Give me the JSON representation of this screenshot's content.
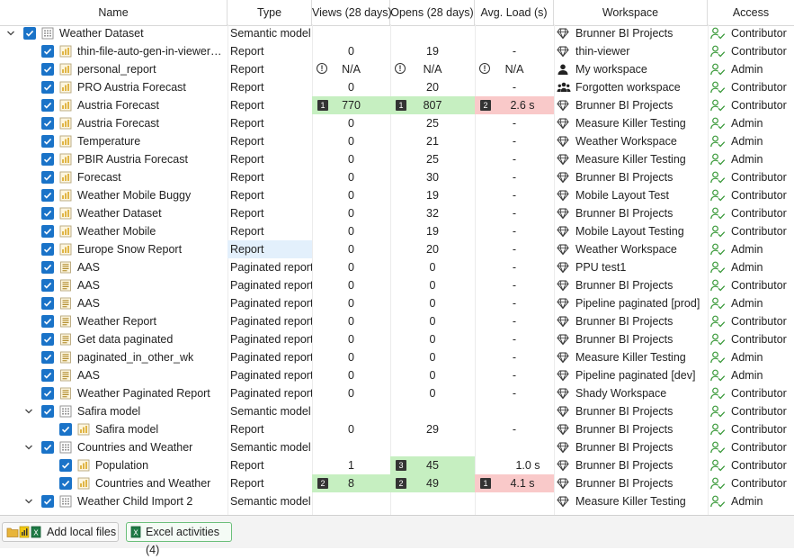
{
  "columns": {
    "name": "Name",
    "type": "Type",
    "views": "Views (28 days)",
    "opens": "Opens (28 days)",
    "load": "Avg. Load (s)",
    "workspace": "Workspace",
    "access": "Access"
  },
  "rows": [
    {
      "indent": 0,
      "expander": "down",
      "icon": "dataset",
      "name": "Weather Dataset",
      "type": "Semantic model",
      "views": "",
      "opens": "",
      "load": "",
      "ws_icon": "diamond",
      "workspace": "Brunner BI Projects",
      "access": "Contributor"
    },
    {
      "indent": 1,
      "icon": "report",
      "name": "thin-file-auto-gen-in-viewer…",
      "type": "Report",
      "views": "0",
      "opens": "19",
      "load": "-",
      "ws_icon": "diamond",
      "workspace": "thin-viewer",
      "access": "Contributor"
    },
    {
      "indent": 1,
      "icon": "report",
      "name": "personal_report",
      "type": "Report",
      "views": "N/A",
      "opens": "N/A",
      "load": "N/A",
      "warn": true,
      "ws_icon": "person",
      "workspace": "My workspace",
      "access": "Admin"
    },
    {
      "indent": 1,
      "icon": "report",
      "name": "PRO Austria Forecast",
      "type": "Report",
      "views": "0",
      "opens": "20",
      "load": "-",
      "ws_icon": "group",
      "workspace": "Forgotten workspace",
      "access": "Contributor"
    },
    {
      "indent": 1,
      "icon": "report",
      "name": "Austria Forecast",
      "type": "Report",
      "views": "770",
      "opens": "807",
      "load": "2.6 s",
      "views_rank": "1",
      "opens_rank": "1",
      "load_rank": "2",
      "views_hl": "green",
      "opens_hl": "green",
      "load_hl": "red",
      "ws_icon": "diamond",
      "workspace": "Brunner BI Projects",
      "access": "Contributor"
    },
    {
      "indent": 1,
      "icon": "report",
      "name": "Austria Forecast",
      "type": "Report",
      "views": "0",
      "opens": "25",
      "load": "-",
      "ws_icon": "diamond",
      "workspace": "Measure Killer Testing",
      "access": "Admin"
    },
    {
      "indent": 1,
      "icon": "report",
      "name": "Temperature",
      "type": "Report",
      "views": "0",
      "opens": "21",
      "load": "-",
      "ws_icon": "diamond",
      "workspace": "Weather Workspace",
      "access": "Admin"
    },
    {
      "indent": 1,
      "icon": "report",
      "name": "PBIR Austria Forecast",
      "type": "Report",
      "views": "0",
      "opens": "25",
      "load": "-",
      "ws_icon": "diamond",
      "workspace": "Measure Killer Testing",
      "access": "Admin"
    },
    {
      "indent": 1,
      "icon": "report",
      "name": "Forecast",
      "type": "Report",
      "views": "0",
      "opens": "30",
      "load": "-",
      "ws_icon": "diamond",
      "workspace": "Brunner BI Projects",
      "access": "Contributor"
    },
    {
      "indent": 1,
      "icon": "report",
      "name": "Weather Mobile Buggy",
      "type": "Report",
      "views": "0",
      "opens": "19",
      "load": "-",
      "ws_icon": "diamond",
      "workspace": "Mobile Layout Test",
      "access": "Contributor"
    },
    {
      "indent": 1,
      "icon": "report",
      "name": "Weather Dataset",
      "type": "Report",
      "views": "0",
      "opens": "32",
      "load": "-",
      "ws_icon": "diamond",
      "workspace": "Brunner BI Projects",
      "access": "Contributor"
    },
    {
      "indent": 1,
      "icon": "report",
      "name": "Weather Mobile",
      "type": "Report",
      "views": "0",
      "opens": "19",
      "load": "-",
      "ws_icon": "diamond",
      "workspace": "Mobile Layout Testing",
      "access": "Contributor"
    },
    {
      "indent": 1,
      "icon": "report",
      "name": "Europe Snow Report",
      "type": "Report",
      "views": "0",
      "opens": "20",
      "load": "-",
      "type_selected": true,
      "ws_icon": "diamond",
      "workspace": "Weather Workspace",
      "access": "Admin"
    },
    {
      "indent": 1,
      "icon": "paginated",
      "name": "AAS",
      "type": "Paginated report",
      "views": "0",
      "opens": "0",
      "load": "-",
      "ws_icon": "diamond",
      "workspace": "PPU test1",
      "access": "Admin"
    },
    {
      "indent": 1,
      "icon": "paginated",
      "name": "AAS",
      "type": "Paginated report",
      "views": "0",
      "opens": "0",
      "load": "-",
      "ws_icon": "diamond",
      "workspace": "Brunner BI Projects",
      "access": "Contributor"
    },
    {
      "indent": 1,
      "icon": "paginated",
      "name": "AAS",
      "type": "Paginated report",
      "views": "0",
      "opens": "0",
      "load": "-",
      "ws_icon": "diamond",
      "workspace": "Pipeline paginated [prod]",
      "access": "Admin"
    },
    {
      "indent": 1,
      "icon": "paginated",
      "name": "Weather Report",
      "type": "Paginated report",
      "views": "0",
      "opens": "0",
      "load": "-",
      "ws_icon": "diamond",
      "workspace": "Brunner BI Projects",
      "access": "Contributor"
    },
    {
      "indent": 1,
      "icon": "paginated",
      "name": "Get data paginated",
      "type": "Paginated report",
      "views": "0",
      "opens": "0",
      "load": "-",
      "ws_icon": "diamond",
      "workspace": "Brunner BI Projects",
      "access": "Contributor"
    },
    {
      "indent": 1,
      "icon": "paginated",
      "name": "paginated_in_other_wk",
      "type": "Paginated report",
      "views": "0",
      "opens": "0",
      "load": "-",
      "ws_icon": "diamond",
      "workspace": "Measure Killer Testing",
      "access": "Admin"
    },
    {
      "indent": 1,
      "icon": "paginated",
      "name": "AAS",
      "type": "Paginated report",
      "views": "0",
      "opens": "0",
      "load": "-",
      "ws_icon": "diamond",
      "workspace": "Pipeline paginated [dev]",
      "access": "Admin"
    },
    {
      "indent": 1,
      "icon": "paginated",
      "name": "Weather Paginated Report",
      "type": "Paginated report",
      "views": "0",
      "opens": "0",
      "load": "-",
      "ws_icon": "diamond",
      "workspace": "Shady Workspace",
      "access": "Contributor"
    },
    {
      "indent": 1,
      "expander": "down",
      "icon": "dataset",
      "name": "Safira model",
      "type": "Semantic model",
      "views": "",
      "opens": "",
      "load": "",
      "ws_icon": "diamond",
      "workspace": "Brunner BI Projects",
      "access": "Contributor"
    },
    {
      "indent": 2,
      "icon": "report",
      "name": "Safira model",
      "type": "Report",
      "views": "0",
      "opens": "29",
      "load": "-",
      "ws_icon": "diamond",
      "workspace": "Brunner BI Projects",
      "access": "Contributor"
    },
    {
      "indent": 1,
      "expander": "down",
      "icon": "dataset",
      "name": "Countries and Weather",
      "type": "Semantic model",
      "views": "",
      "opens": "",
      "load": "",
      "ws_icon": "diamond",
      "workspace": "Brunner BI Projects",
      "access": "Contributor"
    },
    {
      "indent": 2,
      "icon": "report",
      "name": "Population",
      "type": "Report",
      "views": "1",
      "opens": "45",
      "load": "1.0 s",
      "opens_rank": "3",
      "opens_hl": "green",
      "ws_icon": "diamond",
      "workspace": "Brunner BI Projects",
      "access": "Contributor"
    },
    {
      "indent": 2,
      "icon": "report",
      "name": "Countries and Weather",
      "type": "Report",
      "views": "8",
      "opens": "49",
      "load": "4.1 s",
      "views_rank": "2",
      "opens_rank": "2",
      "load_rank": "1",
      "views_hl": "green",
      "opens_hl": "green",
      "load_hl": "red",
      "ws_icon": "diamond",
      "workspace": "Brunner BI Projects",
      "access": "Contributor"
    },
    {
      "indent": 1,
      "expander": "down",
      "icon": "dataset",
      "name": "Weather Child Import 2",
      "type": "Semantic model",
      "views": "",
      "opens": "",
      "load": "",
      "ws_icon": "diamond",
      "workspace": "Measure Killer Testing",
      "access": "Admin"
    }
  ],
  "footer": {
    "add_local_files": "Add local files",
    "excel_activities": "Excel activities (4)"
  },
  "colors": {
    "checkbox": "#1a73c8",
    "highlight_green": "#c6efc1",
    "highlight_red": "#f9c9c9",
    "selection": "#e3f0fc",
    "access_icon": "#3a9a3a"
  }
}
